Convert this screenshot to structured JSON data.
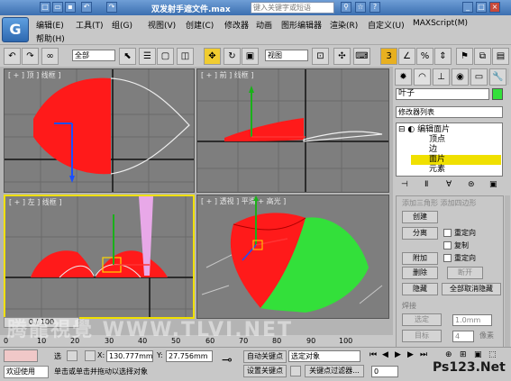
{
  "title_bar": {
    "title": "双发射手遮文件.max",
    "search_placeholder": "键入关键字或短语"
  },
  "menus": [
    "编辑(E)",
    "工具(T)",
    "组(G)",
    "视图(V)",
    "创建(C)",
    "修改器",
    "动画",
    "图形编辑器",
    "渲染(R)",
    "自定义(U)",
    "MAXScript(M)",
    "帮助(H)"
  ],
  "toolbar": {
    "selection_filter": "全部",
    "ref_coord": "视图",
    "snap_value": "3"
  },
  "viewports": {
    "top": "[ + ] 顶 ] 线框 ]",
    "front": "[ + ] 前 ] 线框 ]",
    "left": "[ + ] 左 ] 线框 ]",
    "persp": "[ + ] 透视 ] 平滑 + 高光 ]"
  },
  "cmd": {
    "object_name": "叶子",
    "modifier_list": "修改器列表",
    "stack": [
      "编辑面片",
      "顶点",
      "边",
      "面片",
      "元素"
    ],
    "stack_selected": "面片",
    "rollout_header": "添加三角形   添加四边形",
    "create_btn": "创建",
    "detach_btn": "分离",
    "reorient": "重定向",
    "copy": "复制",
    "attach_btn": "附加",
    "reorient2": "重定向",
    "delete_btn": "删除",
    "break_btn": "断开",
    "hide_btn": "隐藏",
    "unhide_btn": "全部取消隐藏",
    "weld_header": "焊接",
    "selected_btn": "选定",
    "weld_value": "1.0mm",
    "target_btn": "目标",
    "target_value": "4",
    "pixels": "像素"
  },
  "time": {
    "slider": "0 / 100",
    "ticks": [
      "0",
      "10",
      "20",
      "30",
      "40",
      "50",
      "60",
      "70",
      "80",
      "90",
      "100"
    ]
  },
  "status": {
    "welcome": "欢迎使用",
    "sel_label": "选",
    "x_label": "X:",
    "x_value": "130.777mm",
    "y_label": "Y:",
    "y_value": "27.756mm",
    "autokey": "自动关键点",
    "selected_obj": "选定对象",
    "setkey": "设置关键点",
    "keyfilter": "关键点过滤器...",
    "prompt": "单击或单击并拖动以选择对象",
    "frame_value": "0"
  },
  "watermark": "腾龍視覺 WWW.TLVI.NET",
  "ps123": "Ps123.Net",
  "colors": {
    "red": "#ff1a1a",
    "green": "#33e03a",
    "viewport_bg": "#7e7e7e",
    "selected_row": "#f0e000"
  }
}
